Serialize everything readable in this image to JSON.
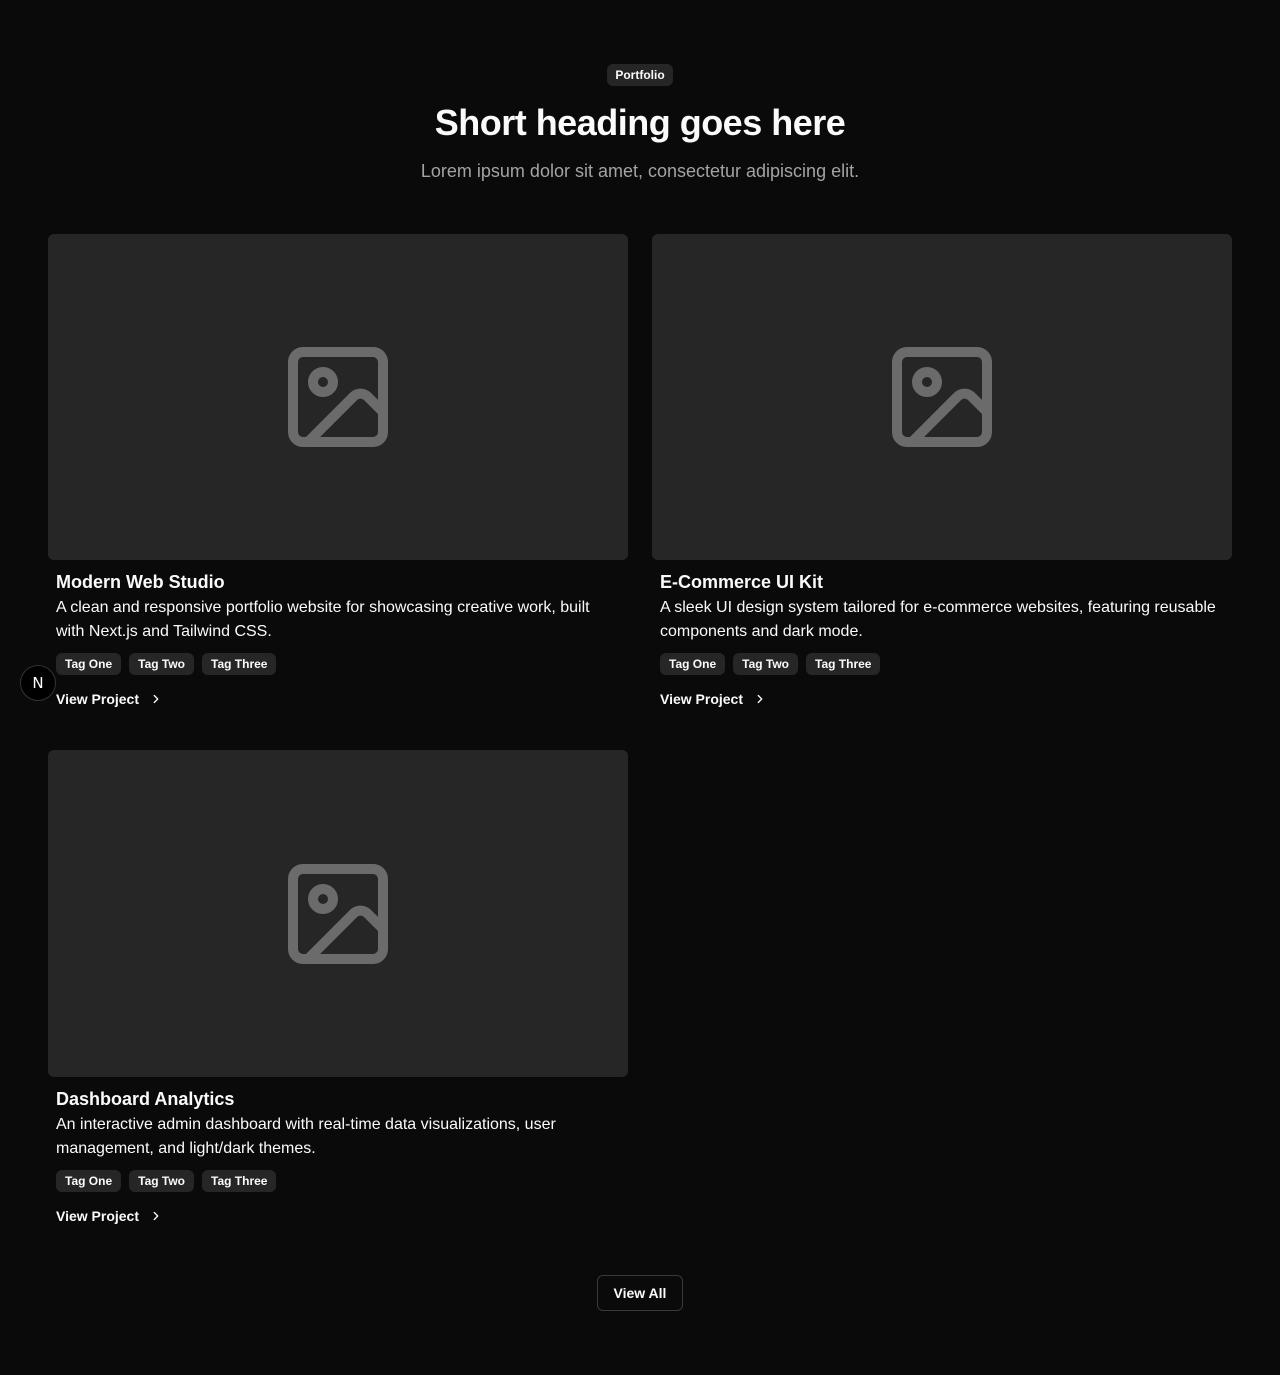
{
  "header": {
    "badge": "Portfolio",
    "heading": "Short heading goes here",
    "subheading": "Lorem ipsum dolor sit amet, consectetur adipiscing elit."
  },
  "projects": [
    {
      "title": "Modern Web Studio",
      "description": "A clean and responsive portfolio website for showcasing creative work, built with Next.js and Tailwind CSS.",
      "tags": [
        "Tag One",
        "Tag Two",
        "Tag Three"
      ],
      "link_label": "View Project"
    },
    {
      "title": "E-Commerce UI Kit",
      "description": "A sleek UI design system tailored for e-commerce websites, featuring reusable components and dark mode.",
      "tags": [
        "Tag One",
        "Tag Two",
        "Tag Three"
      ],
      "link_label": "View Project"
    },
    {
      "title": "Dashboard Analytics",
      "description": "An interactive admin dashboard with real-time data visualizations, user management, and light/dark themes.",
      "tags": [
        "Tag One",
        "Tag Two",
        "Tag Three"
      ],
      "link_label": "View Project"
    }
  ],
  "footer": {
    "view_all_label": "View All"
  },
  "dev_badge": {
    "letter": "N",
    "icon": "nextjs-logo-icon"
  },
  "icons": {
    "image_placeholder": "image-placeholder-icon",
    "link_chevron": "chevron-right-icon"
  },
  "colors": {
    "background": "#0a0a0a",
    "surface": "#262626",
    "text": "#fafafa",
    "muted_text": "#a3a3a3",
    "placeholder_icon": "#6b6b6b"
  }
}
